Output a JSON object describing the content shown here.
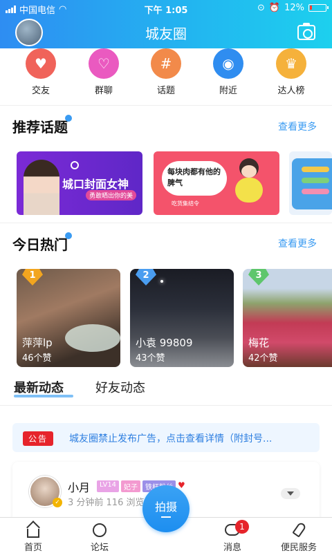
{
  "status": {
    "carrier": "中国电信",
    "time": "下午 1:05",
    "battery": "12%"
  },
  "header": {
    "title": "城友圈"
  },
  "categories": [
    {
      "label": "交友",
      "color": "#f0635a",
      "glyph": "♥"
    },
    {
      "label": "群聊",
      "color": "#ea5ac0",
      "glyph": "♥"
    },
    {
      "label": "话题",
      "color": "#f28a4a",
      "glyph": "#"
    },
    {
      "label": "附近",
      "color": "#2f8df0",
      "glyph": "◉"
    },
    {
      "label": "达人榜",
      "color": "#f5b13b",
      "glyph": "♛"
    }
  ],
  "topics": {
    "title": "推荐话题",
    "more": "查看更多",
    "cards": [
      {
        "main": "城口封面女神",
        "sub": "勇敢晒出你的美"
      },
      {
        "main": "每块肉都有他的脾气",
        "sub": "吃货集结令"
      }
    ]
  },
  "hot": {
    "title": "今日热门",
    "more": "查看更多",
    "items": [
      {
        "rank": "1",
        "name": "萍萍lp",
        "likes": "46个赞"
      },
      {
        "rank": "2",
        "name": "小袁 99809",
        "likes": "43个赞"
      },
      {
        "rank": "3",
        "name": "梅花",
        "likes": "42个赞"
      }
    ]
  },
  "feed_tabs": {
    "latest": "最新动态",
    "friends": "好友动态"
  },
  "notice": {
    "badge": "公告",
    "text": "城友圈禁止发布广告，点击查看详情（附封号..."
  },
  "post": {
    "username": "小月",
    "tags": [
      "LV14",
      "妃子",
      "铁杆粉丝"
    ],
    "meta": "3 分钟前  116 浏览"
  },
  "tabbar": {
    "home": "首页",
    "forum": "论坛",
    "shoot": "拍摄",
    "messages": "消息",
    "messages_badge": "1",
    "services": "便民服务"
  }
}
